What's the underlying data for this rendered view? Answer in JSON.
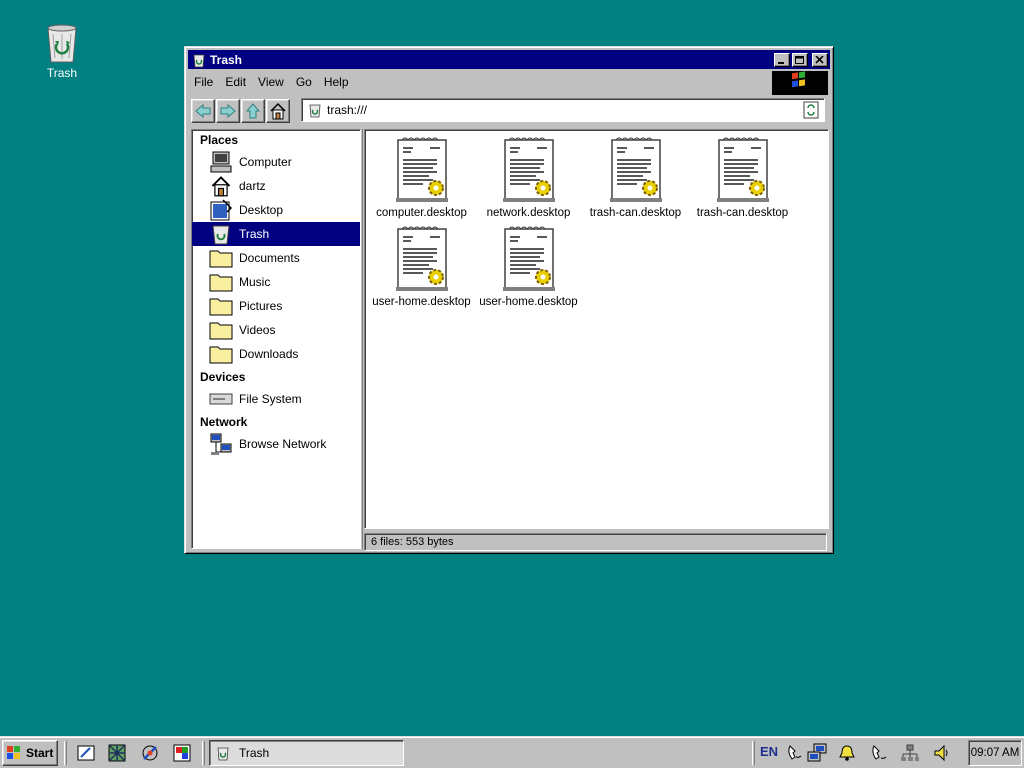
{
  "desktop": {
    "trash_label": "Trash"
  },
  "window": {
    "title": "Trash",
    "menu": [
      "File",
      "Edit",
      "View",
      "Go",
      "Help"
    ],
    "address": "trash:///",
    "sidebar": {
      "places_header": "Places",
      "places": [
        "Computer",
        "dartz",
        "Desktop",
        "Trash",
        "Documents",
        "Music",
        "Pictures",
        "Videos",
        "Downloads"
      ],
      "devices_header": "Devices",
      "devices": [
        "File System"
      ],
      "network_header": "Network",
      "network": [
        "Browse Network"
      ]
    },
    "files": [
      "computer.desktop",
      "network.desktop",
      "trash-can.desktop",
      "trash-can.desktop",
      "user-home.desktop",
      "user-home.desktop"
    ],
    "status": "6 files: 553 bytes"
  },
  "taskbar": {
    "start_label": "Start",
    "task_label": "Trash",
    "lang": "EN",
    "clock": "09:07 AM"
  },
  "colors": {
    "desktop": "#008080",
    "titlebar": "#000080",
    "selection": "#000080",
    "chrome": "#c0c0c0"
  }
}
